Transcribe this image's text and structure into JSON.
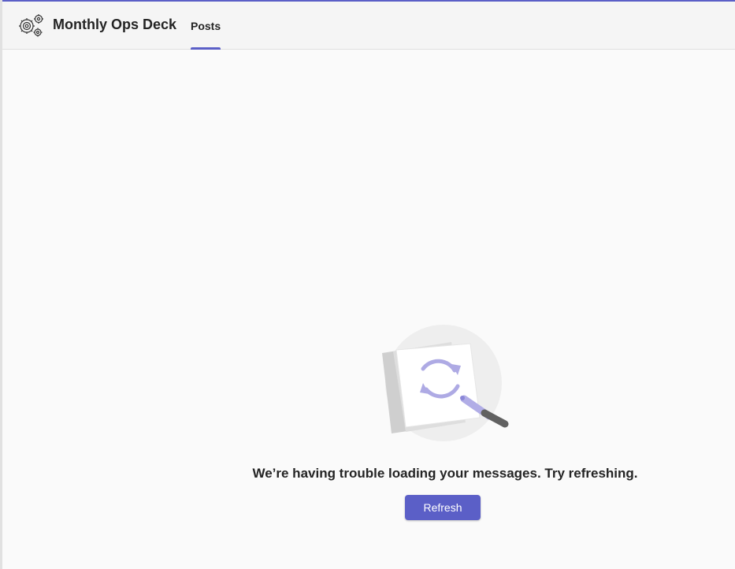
{
  "header": {
    "team_name": "Monthly Ops Deck",
    "logo_icon": "gears-icon",
    "tabs": [
      {
        "label": "Posts",
        "active": true
      }
    ]
  },
  "empty_state": {
    "illustration_icon": "refresh-notepad-illustration",
    "message": "We’re having trouble loading your messages. Try refreshing.",
    "refresh_label": "Refresh"
  },
  "colors": {
    "accent": "#5b5fc7",
    "text": "#242424",
    "background": "#fafafa",
    "header_background": "#f5f5f5"
  }
}
